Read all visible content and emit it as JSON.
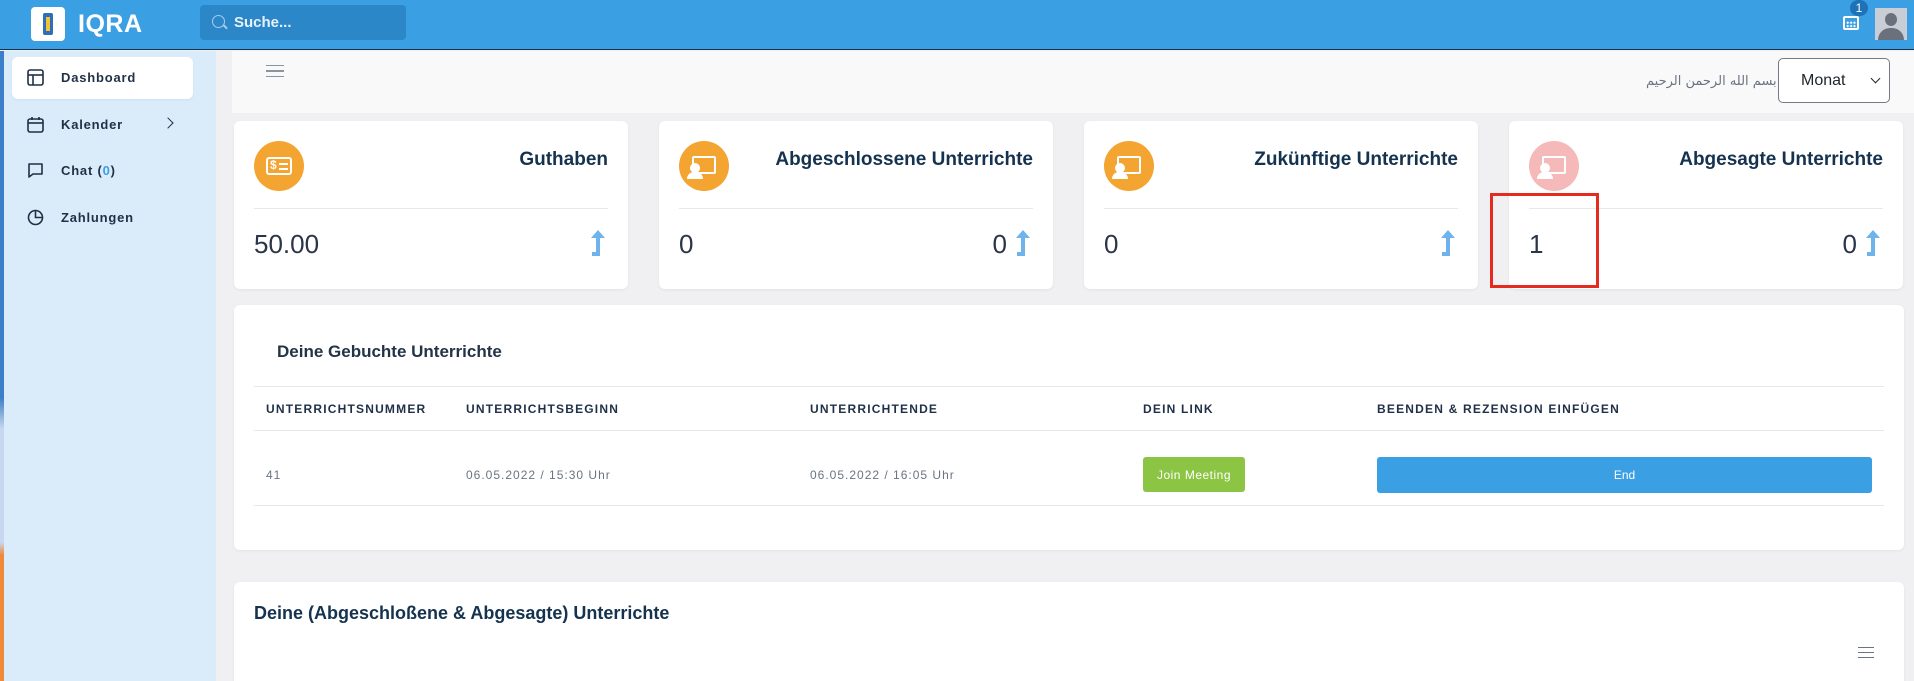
{
  "app": {
    "brand": "IQRA"
  },
  "search": {
    "placeholder": "Suche..."
  },
  "notifications": {
    "count": "1"
  },
  "sidebar": {
    "items": [
      {
        "label": "Dashboard",
        "icon": "layout-icon"
      },
      {
        "label": "Kalender",
        "icon": "calendar-icon"
      },
      {
        "label": "Chat (",
        "count": "0",
        "suffix": ")",
        "icon": "chat-icon"
      },
      {
        "label": "Zahlungen",
        "icon": "pie-chart-icon"
      }
    ]
  },
  "subheader": {
    "bismillah": "بسم الله الرحمن الرحيم",
    "period": "Monat"
  },
  "cards": [
    {
      "title": "Guthaben",
      "value": "50.00",
      "trend": "",
      "icon": "bill-icon"
    },
    {
      "title": "Abgeschlossene Unterrichte",
      "value": "0",
      "trend": "0",
      "icon": "presentation-icon"
    },
    {
      "title": "Zukünftige Unterrichte",
      "value": "0",
      "trend": "",
      "icon": "presentation-icon"
    },
    {
      "title": "Abgesagte Unterrichte",
      "value": "1",
      "trend": "0",
      "icon": "presentation-icon"
    }
  ],
  "booked": {
    "title": "Deine Gebuchte Unterrichte",
    "headers": [
      "UNTERRICHTSNUMMER",
      "UNTERRICHTSBEGINN",
      "UNTERRICHTENDE",
      "DEIN LINK",
      "BEENDEN & REZENSION EINFÜGEN"
    ],
    "rows": [
      {
        "number": "41",
        "start": "06.05.2022 / 15:30 Uhr",
        "end": "06.05.2022 / 16:05 Uhr",
        "link_label": "Join Meeting",
        "end_label": "End"
      }
    ]
  },
  "history": {
    "title": "Deine (Abgeschloßene & Abgesagte) Unterrichte"
  },
  "colors": {
    "primary": "#3a9fe3",
    "accent": "#f4a431",
    "success": "#8cc444",
    "highlight": "#e52b1f"
  }
}
